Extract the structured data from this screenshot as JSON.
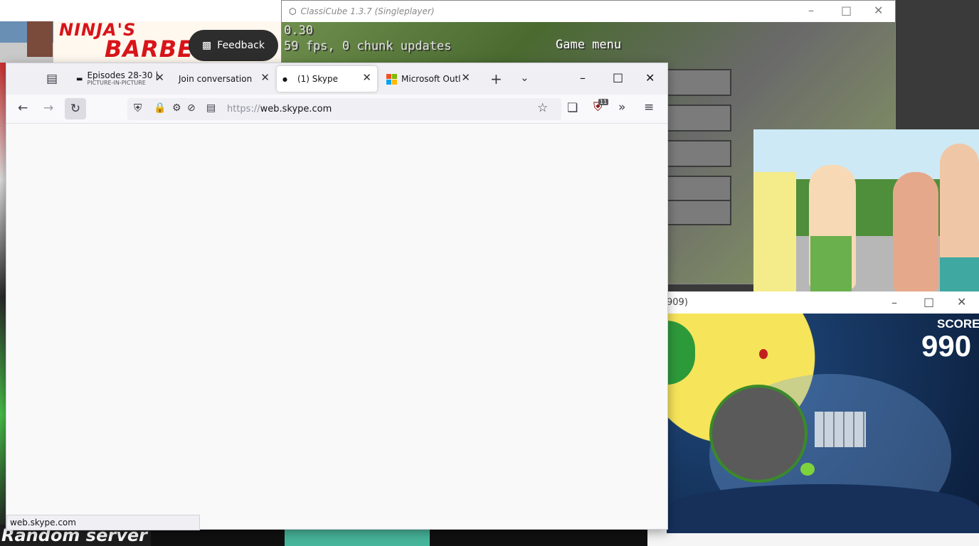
{
  "background": {
    "sign_line1": "NINJA'S",
    "sign_line2": "BARBER SHOP",
    "feedback_label": "Feedback",
    "random_server": "Random server"
  },
  "classicube": {
    "title": "ClassiCube 1.3.7 (Singleplayer)",
    "version": "0.30",
    "fps_text": "59 fps, 0 chunk updates",
    "game_menu": "Game menu"
  },
  "angry_birds": {
    "title_fragment": "909)",
    "score_label": "SCORE",
    "score_value": "990"
  },
  "firefox": {
    "tabs": [
      {
        "label": "Episodes 28-30 |",
        "sublabel": "PICTURE-IN-PICTURE"
      },
      {
        "label": "Join conversation"
      },
      {
        "label": "(1) Skype"
      },
      {
        "label": "Microsoft Outlook"
      }
    ],
    "url": "https://web.skype.com",
    "url_scheme": "https://",
    "url_domain": "web.skype.com",
    "status_text": "web.skype.com",
    "ublock_badge": "11"
  },
  "colors": {
    "accent_active_tab": "#ffffff",
    "ublock_red": "#800000"
  }
}
